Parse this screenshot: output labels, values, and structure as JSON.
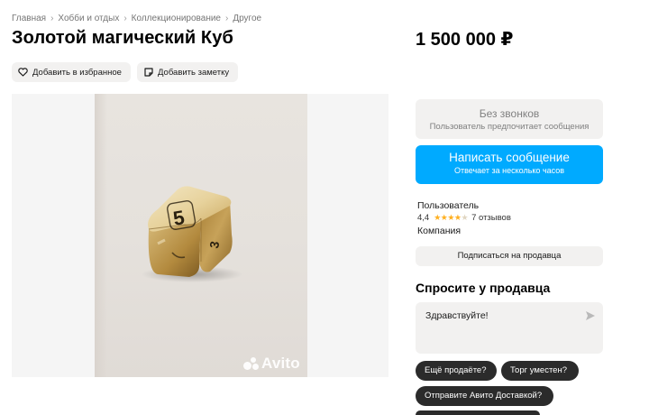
{
  "breadcrumb": [
    "Главная",
    "Хобби и отдых",
    "Коллекционирование",
    "Другое"
  ],
  "title": "Золотой магический Куб",
  "price": "1 500 000 ₽",
  "actions": {
    "favorite_label": "Добавить в избранное",
    "note_label": "Добавить заметку"
  },
  "gallery": {
    "watermark": "Avito",
    "die_face": "5",
    "die_side": "3"
  },
  "contact": {
    "no_calls_title": "Без звонков",
    "no_calls_sub": "Пользователь предпочитает сообщения",
    "message_button": "Написать сообщение",
    "message_sub": "Отвечает за несколько часов"
  },
  "seller": {
    "name": "Пользователь",
    "rating": "4,4",
    "reviews": "7 отзывов",
    "type": "Компания",
    "subscribe": "Подписаться на продавца",
    "stars": "★★★★★"
  },
  "ask": {
    "title": "Спросите у продавца",
    "message": "Здравствуйте!",
    "chips": [
      "Ещё продаёте?",
      "Торг уместен?",
      "Отправите Авито Доставкой?"
    ]
  },
  "colors": {
    "accent": "#00aaff",
    "chip": "#2b2b2b",
    "surface": "#f2f1f0",
    "star": "#ffb021"
  }
}
